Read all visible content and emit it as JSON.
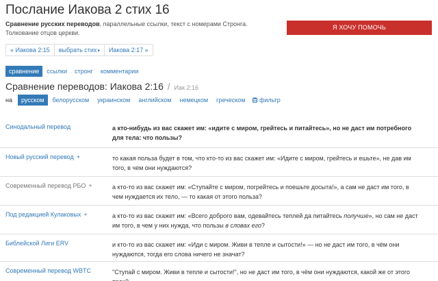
{
  "page": {
    "title": "Послание Иакова 2 стих 16",
    "subtitle_bold": "Сравнение русских переводов",
    "subtitle_rest": ", параллельные ссылки, текст с номерами Стронга.",
    "subtitle_line2": "Толкование отцов церкви.",
    "help_button": "Я ХОЧУ ПОМОЧЬ"
  },
  "pager": {
    "prev": "« Иакова 2:15",
    "select": "выбрать стих",
    "select_caret": "▾",
    "next": "Иакова 2:17 »"
  },
  "tabs": [
    "сравнение",
    "ссылки",
    "стронг",
    "комментарии"
  ],
  "section": {
    "title": "Сравнение переводов: Иакова 2:16",
    "sep": "/",
    "small": "Иак 2:16"
  },
  "languages": {
    "label": "на",
    "items": [
      "русском",
      "белорусском",
      "украинском",
      "английском",
      "немецком",
      "греческом"
    ],
    "filter_icon": "filter-icon",
    "filter_label": "фильтр"
  },
  "translations": [
    {
      "name": "Синодальный перевод",
      "plus": "",
      "text": "а кто-нибудь из вас скажет им: «идите с миром, грейтесь и питайтесь», но не даст им потребного для тела: что пользы?"
    },
    {
      "name": "Новый русский перевод",
      "plus": "+",
      "text": "то какая польза будет в том, что кто-то из вас скажет им: «Идите с миром, грейтесь и ешьте», не дав им того, в чем они нуждаются?"
    },
    {
      "name": "Современный перевод РБО",
      "plus": "+",
      "text": "а кто-то из вас скажет им: «Ступайте с миром, погрейтесь и поешьте досыта!», а сам не даст им того, в чем нуждается их тело, — то какая от этого польза?"
    },
    {
      "name": "Под редакцией Кулаковых",
      "plus": "+",
      "text_a": "а кто-то из вас скажет им: «Всего доброго вам, одевайтесь теплей да питайтесь ",
      "text_i1": "получше",
      "text_b": "», но сам не даст им того, в чем у них нужда, что пользы ",
      "text_i2": "в словах его",
      "text_c": "?"
    },
    {
      "name": "Библейской Лиги ERV",
      "plus": "",
      "text": "и кто-то из вас скажет им: «Иди с миром. Живи в тепле и сытости!» — но не даст им того, в чём они нуждаются, тогда его слова ничего не значат?"
    },
    {
      "name": "Современный перевод WBTC",
      "plus": "",
      "text": "\"Ступай с миром. Живи в тепле и сытости!\", но не даст им того, в чём они нуждаются, какой же от этого прок?"
    }
  ]
}
